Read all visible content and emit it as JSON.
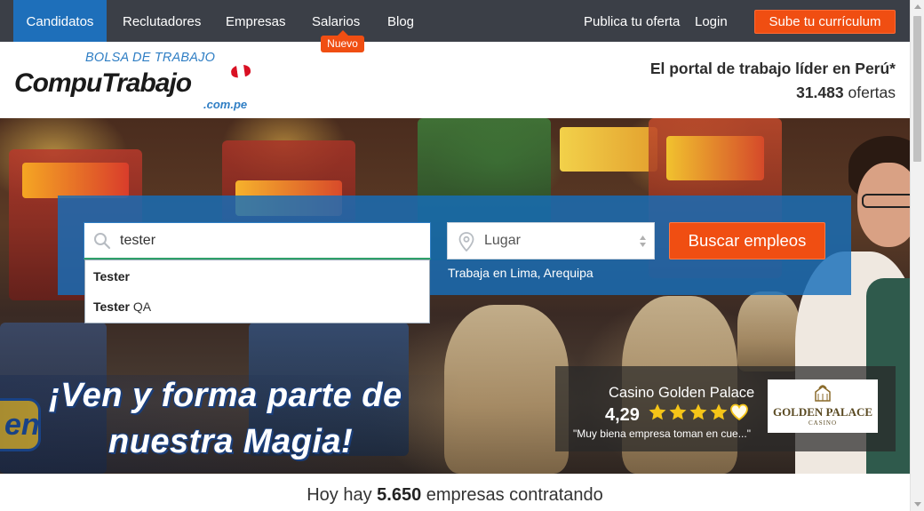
{
  "nav": {
    "items": [
      {
        "label": "Candidatos",
        "active": true
      },
      {
        "label": "Reclutadores",
        "active": false
      },
      {
        "label": "Empresas",
        "active": false
      },
      {
        "label": "Salarios",
        "active": false
      },
      {
        "label": "Blog",
        "active": false
      }
    ],
    "new_badge": "Nuevo",
    "publish_label": "Publica tu oferta",
    "login_label": "Login",
    "cv_button_label": "Sube tu currículum"
  },
  "header": {
    "logo_tagline": "BOLSA DE TRABAJO",
    "logo_name": "CompuTrabajo",
    "logo_domain": ".com.pe",
    "headline": "El portal de trabajo líder en Perú*",
    "offers_count": "31.483",
    "offers_label": "ofertas"
  },
  "search": {
    "query_value": "tester",
    "suggestions": [
      {
        "bold": "Tester",
        "rest": ""
      },
      {
        "bold": "Tester",
        "rest": " QA"
      }
    ],
    "place_value": "Lugar",
    "place_hint": "Trabaja en Lima, Arequipa",
    "button_label": "Buscar empleos"
  },
  "hero": {
    "slogan_line1": "¡Ven y forma parte de",
    "slogan_line2": "nuestra Magia!",
    "badge_text": "en",
    "company": {
      "name": "Casino Golden Palace",
      "rating": "4,29",
      "stars_filled": 4,
      "stars_total": 5,
      "review": "\"Muy biena empresa toman en cue...\"",
      "logo_text": "GOLDEN PALACE",
      "logo_subtext": "CASINO"
    }
  },
  "summary": {
    "prefix": "Hoy hay",
    "count": "5.650",
    "suffix": "empresas contratando"
  },
  "colors": {
    "nav_bg": "#3b3f47",
    "nav_active": "#1e6fba",
    "accent_orange": "#f04e12",
    "brand_blue": "#2f7ec4",
    "star_gold": "#f5c518"
  }
}
